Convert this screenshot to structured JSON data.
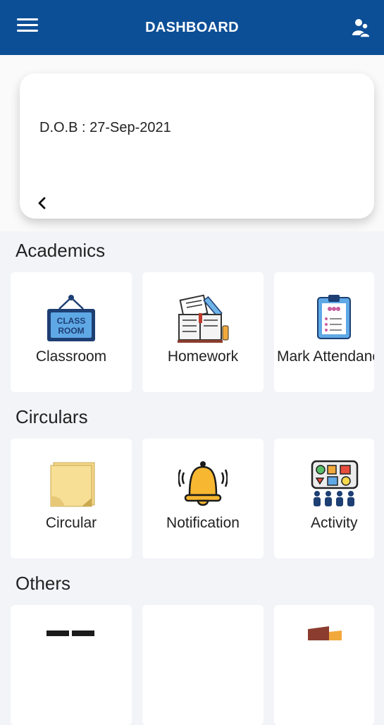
{
  "header": {
    "title": "DASHBOARD",
    "menu_icon": "menu-icon",
    "profile_icon": "profile-switch-icon"
  },
  "student_card": {
    "dob": "D.O.B : 27-Sep-2021",
    "back_icon": "chevron-left-icon"
  },
  "sections": {
    "academics": {
      "title": "Academics",
      "items": [
        "Classroom",
        "Homework",
        "Mark Attendance"
      ]
    },
    "circulars": {
      "title": "Circulars",
      "items": [
        "Circular",
        "Notification",
        "Activity"
      ]
    },
    "others": {
      "title": "Others"
    }
  },
  "icons": {
    "classroom": "classroom-sign-icon",
    "homework": "homework-book-icon",
    "attendance": "clipboard-attendance-icon",
    "circular": "sticky-note-icon",
    "notification": "bell-icon",
    "activity": "activity-board-icon"
  },
  "colors": {
    "appbar": "#0c4f97",
    "background": "#f2f4f8"
  }
}
